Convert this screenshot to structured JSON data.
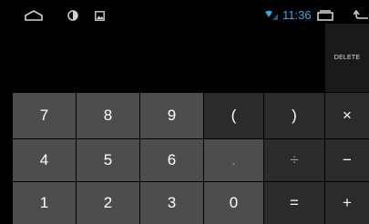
{
  "status_bar": {
    "icons_left": [
      "home-outline-icon",
      "brightness-icon",
      "image-icon"
    ],
    "time": "11:36",
    "icons_right": [
      "wifi-signal-icon",
      "recent-apps-icon",
      "back-icon"
    ],
    "accent_color": "#36a8e0"
  },
  "display": {
    "value": ""
  },
  "delete_label": "DELETE",
  "keypad": {
    "rows": [
      [
        "7",
        "8",
        "9",
        "(",
        ")",
        "×"
      ],
      [
        "4",
        "5",
        "6",
        ".",
        "÷",
        "−"
      ],
      [
        "1",
        "2",
        "3",
        "0",
        "=",
        "+"
      ]
    ]
  },
  "colors": {
    "digit_key": "#4d4d4d",
    "operator_key": "#2b2b2b",
    "background": "#000000"
  }
}
